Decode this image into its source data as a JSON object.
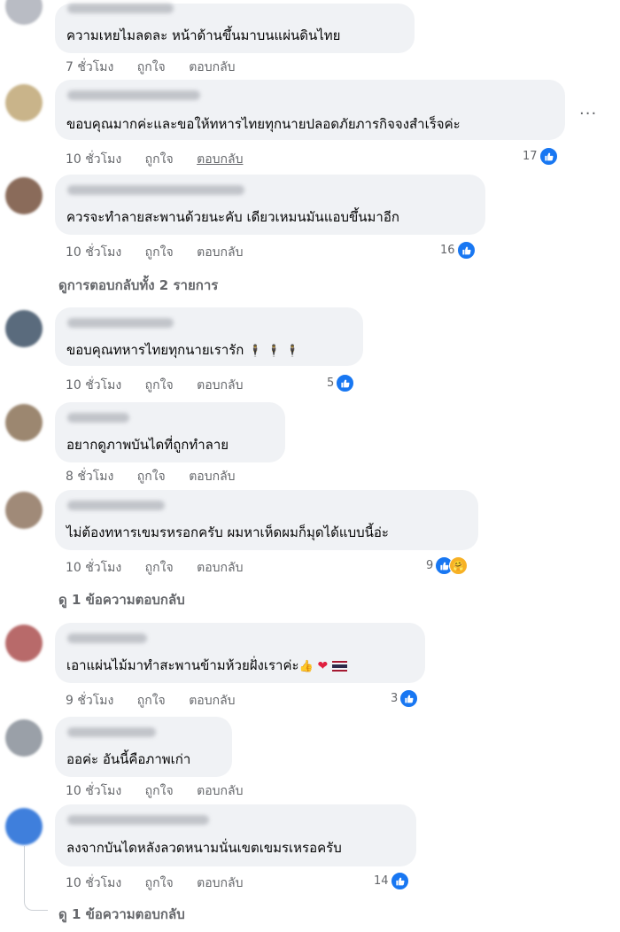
{
  "comments": [
    {
      "text": "ความเหยไมลดละ หน้าด้านขึ้นมาบนแผ่นดินไทย",
      "time": "7 ชั่วโมง",
      "like": "ถูกใจ",
      "reply": "ตอบกลับ",
      "count": ""
    },
    {
      "text": "ขอบคุณมากค่ะและขอให้ทหารไทยทุกนายปลอดภัยภารกิจจงสำเร็จค่ะ",
      "time": "10 ชั่วโมง",
      "like": "ถูกใจ",
      "reply": "ตอบกลับ",
      "count": "17"
    },
    {
      "text": "ควรจะทำลายสะพานด้วยนะคับ เดียวเหมนมันแอบขึ้นมาอีก",
      "time": "10 ชั่วโมง",
      "like": "ถูกใจ",
      "reply": "ตอบกลับ",
      "count": "16",
      "replies": "ดูการตอบกลับทั้ง 2 รายการ"
    },
    {
      "text": "ขอบคุณทหารไทยทุกนายเรารัก",
      "time": "10 ชั่วโมง",
      "like": "ถูกใจ",
      "reply": "ตอบกลับ",
      "count": "5"
    },
    {
      "text": "อยากดูภาพบันไดที่ถูกทำลาย",
      "time": "8 ชั่วโมง",
      "like": "ถูกใจ",
      "reply": "ตอบกลับ",
      "count": ""
    },
    {
      "text": "ไม่ต้องทหารเขมรหรอกครับ ผมหาเห็ดผมก็มุดได้แบบนี้อ่ะ",
      "time": "10 ชั่วโมง",
      "like": "ถูกใจ",
      "reply": "ตอบกลับ",
      "count": "9",
      "replies": "ดู 1 ข้อความตอบกลับ"
    },
    {
      "text": "เอาแผ่นไม้มาทำสะพานข้ามห้วยฝั่งเราค่ะ",
      "time": "9 ชั่วโมง",
      "like": "ถูกใจ",
      "reply": "ตอบกลับ",
      "count": "3"
    },
    {
      "text": "ออค่ะ อันนี้คือภาพเก่า",
      "time": "10 ชั่วโมง",
      "like": "ถูกใจ",
      "reply": "ตอบกลับ",
      "count": ""
    },
    {
      "text": "ลงจากบันไดหลังลวดหนามนั่นเขตเขมรเหรอครับ",
      "time": "10 ชั่วโมง",
      "like": "ถูกใจ",
      "reply": "ตอบกลับ",
      "count": "14",
      "replies": "ดู 1 ข้อความตอบกลับ"
    }
  ],
  "more_icon": "···",
  "emoji": {
    "man": "🕴",
    "thumb": "👍",
    "heart": "❤",
    "hug": "🤗"
  },
  "colors": {
    "like_blue": "#1877f2",
    "meta_gray": "#65676b",
    "bubble": "#f0f2f5"
  }
}
